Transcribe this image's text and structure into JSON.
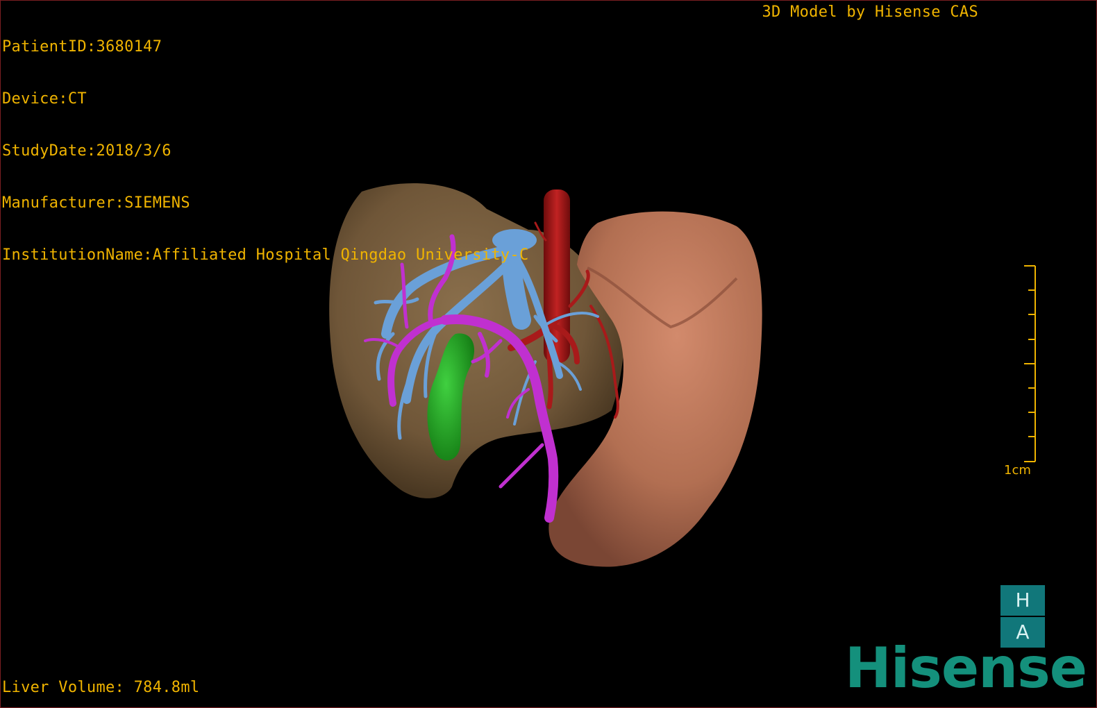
{
  "patient_info": {
    "patient_id": "PatientID:3680147",
    "device": "Device:CT",
    "study_date": "StudyDate:2018/3/6",
    "manufacturer": "Manufacturer:SIEMENS",
    "institution": "InstitutionName:Affiliated Hospital Qingdao University-C"
  },
  "header_right": "3D Model by Hisense CAS",
  "liver_volume": "Liver Volume: 784.8ml",
  "scale_label": "1cm",
  "orientation": {
    "top": "H",
    "bottom": "A"
  },
  "logo": "Hisense",
  "colors": {
    "text": "#f0b400",
    "liver": "#7a6040",
    "stomach": "#c07a5e",
    "hepatic_vein": "#6aa0d8",
    "portal_vein": "#c030d0",
    "artery": "#a81a1a",
    "gallbladder": "#22a822",
    "orientation_box": "#11777a",
    "logo": "#14907c"
  }
}
